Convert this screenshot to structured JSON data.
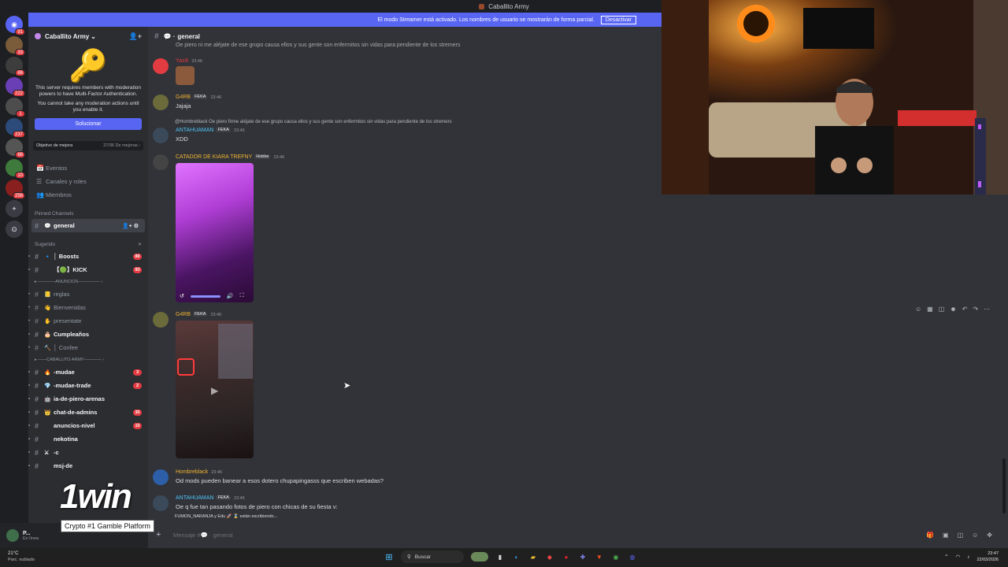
{
  "window": {
    "title": "Caballito Army"
  },
  "banner": {
    "text": "El modo Streamer está activado. Los nombres de usuario se mostrarán de forma parcial.",
    "button": "Desactivar"
  },
  "rail": {
    "servers": [
      {
        "name": "direct-messages",
        "badge": "91",
        "color": "#5865f2",
        "glyph": "◉"
      },
      {
        "name": "server-1",
        "badge": "33",
        "color": "#7a5c3a",
        "glyph": ""
      },
      {
        "name": "server-2",
        "badge": "86",
        "color": "#3d3d3d",
        "glyph": ""
      },
      {
        "name": "server-3",
        "badge": "222",
        "color": "#6a3fb5",
        "glyph": ""
      },
      {
        "name": "server-4",
        "badge": "1",
        "color": "#4d4d4d",
        "glyph": ""
      },
      {
        "name": "server-5",
        "badge": "237",
        "color": "#2d4b7a",
        "glyph": ""
      },
      {
        "name": "server-6",
        "badge": "66",
        "color": "#555555",
        "glyph": ""
      },
      {
        "name": "server-7",
        "badge": "10",
        "color": "#3e7a3b",
        "glyph": ""
      },
      {
        "name": "server-8",
        "badge": "256",
        "color": "#8a1f1f",
        "glyph": ""
      }
    ],
    "add_glyph": "+",
    "explore_glyph": "⊙"
  },
  "server": {
    "name": "Caballito Army",
    "chevron": "⌄",
    "mfa": {
      "line1": "This server requires members with moderation powers to have Multi-Factor Authentication.",
      "line2": "You cannot take any moderation actions until you enable it.",
      "button": "Solucionar"
    },
    "goal": {
      "label": "Objetivo de mejora",
      "value": "27/36 De mejoras ›"
    },
    "menu": [
      {
        "label": "Eventos",
        "icon": "📅"
      },
      {
        "label": "Canales y roles",
        "icon": "☰"
      },
      {
        "label": "Miembros",
        "icon": "👥"
      }
    ],
    "pinned_label": "Pinned Channels",
    "selected_channel": "general",
    "suggested_label": "Sugerido",
    "suggested": [
      {
        "emoji": "🔹",
        "label": "│ Boosts",
        "count": "89"
      },
      {
        "emoji": "",
        "label": "【🟢】KICK",
        "count": "93"
      }
    ],
    "cat_anuncios": "▸ ————ANUNCIOS————— ›",
    "anuncios": [
      {
        "emoji": "📒",
        "label": "reglas",
        "bold": false
      },
      {
        "emoji": "👋",
        "label": "Bienvenidas",
        "bold": false
      },
      {
        "emoji": "✋",
        "label": "presentate",
        "bold": false
      },
      {
        "emoji": "🎂",
        "label": "Cumpleaños",
        "bold": true
      },
      {
        "emoji": "🔨",
        "label": "│ Confee",
        "bold": false
      }
    ],
    "cat_army": "▸ ——CABALLITO ARMY———— ›",
    "army": [
      {
        "emoji": "🔥",
        "label": "-mudae",
        "bold": true,
        "count": "3"
      },
      {
        "emoji": "💎",
        "label": "-mudae-trade",
        "bold": true,
        "count": "2"
      },
      {
        "emoji": "🤖",
        "label": "ia-de-piero-arenas",
        "bold": true,
        "count": ""
      },
      {
        "emoji": "👑",
        "label": "chat-de-admins",
        "bold": true,
        "count": "30"
      },
      {
        "emoji": "",
        "label": "anuncios-nivel",
        "bold": true,
        "count": "10"
      },
      {
        "emoji": "",
        "label": "nekotina",
        "bold": true,
        "count": ""
      },
      {
        "emoji": "⚔",
        "label": "-c",
        "bold": true,
        "count": ""
      },
      {
        "emoji": "",
        "label": "msj-de",
        "bold": true,
        "count": ""
      }
    ]
  },
  "user": {
    "name": "P...",
    "status": "En línea"
  },
  "overlay": {
    "logo": "1win",
    "tag": "Crypto #1 Gamble Platform"
  },
  "chat": {
    "channel": "general",
    "partial_line": "Oe piero ni me aléjate de ese grupo causa  ellos y sus gente son enfermitos sin vidas para pendiente de los stremers",
    "messages": [
      {
        "author": "Yaxili",
        "author_color": "#e23b41",
        "time": "23:46",
        "text": "",
        "tag": ""
      },
      {
        "author": "G4RB",
        "author_color": "#f0b232",
        "time": "23:46",
        "text": "Jajaja",
        "tag": "FEKA"
      },
      {
        "author": "ANTAHUAMAN",
        "author_color": "#4fc3f7",
        "time": "23:46",
        "text": "XDD",
        "tag": "FEKA",
        "reply": "@Hombreblack Oe piero firme aléjate de ese grupo causa  ellos y sus gente son enfermitos sin vidas para pendiente de los stremers"
      },
      {
        "author": "CATADOR DE KIARA TREFNY",
        "author_color": "#f0b232",
        "time": "23:46",
        "text": "",
        "tag": "Hobbe"
      },
      {
        "author": "G4RB",
        "author_color": "#f0b232",
        "time": "23:46",
        "text": "",
        "tag": "FEKA"
      },
      {
        "author": "Hombreblack",
        "author_color": "#f0b232",
        "time": "23:46",
        "text": "Od mods pueden banear a esos dotero chupapingasss que escriben webadas?",
        "tag": ""
      },
      {
        "author": "ANTAHUAMAN",
        "author_color": "#4fc3f7",
        "time": "23:46",
        "text": "Oe q fue tan pasando fotos de piero con chicas de su fiesta v:",
        "tag": "FEKA"
      }
    ],
    "typing": "FUMON_NARANJA y Edu 🚀 ⌛ están escribiendo...",
    "input_placeholder": "Mensaje #💬 · general"
  },
  "taskbar": {
    "weather_temp": "21°C",
    "weather_desc": "Parc. nublado",
    "search": "Buscar",
    "time": "23:47",
    "date": "22/03/2026"
  }
}
